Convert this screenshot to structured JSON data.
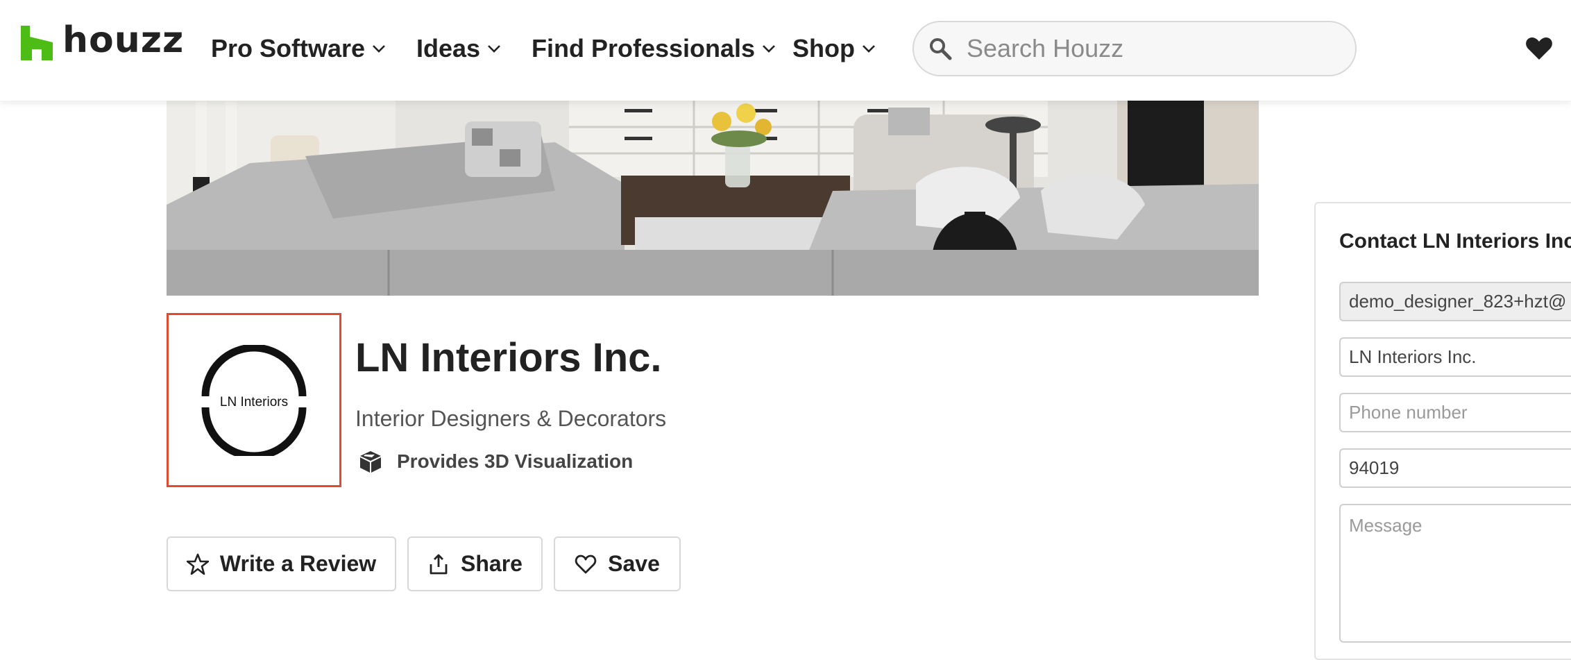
{
  "brand": {
    "name": "houzz",
    "color": "#4dbc15"
  },
  "nav": [
    {
      "label": "Pro Software"
    },
    {
      "label": "Ideas"
    },
    {
      "label": "Find Professionals"
    },
    {
      "label": "Shop"
    }
  ],
  "search": {
    "placeholder": "Search Houzz"
  },
  "profile": {
    "logo_text": "LN Interiors",
    "name": "LN Interiors Inc.",
    "category": "Interior Designers & Decorators",
    "feature": "Provides 3D Visualization"
  },
  "actions": {
    "review": "Write a Review",
    "share": "Share",
    "save": "Save"
  },
  "contact": {
    "title": "Contact LN Interiors Inc",
    "email_value": "demo_designer_823+hzt@",
    "name_value": "LN Interiors Inc.",
    "phone_placeholder": "Phone number",
    "zip_value": "94019",
    "message_placeholder": "Message"
  },
  "colors": {
    "logo_border": "#e04a2f",
    "text": "#222222",
    "muted": "#555555"
  }
}
